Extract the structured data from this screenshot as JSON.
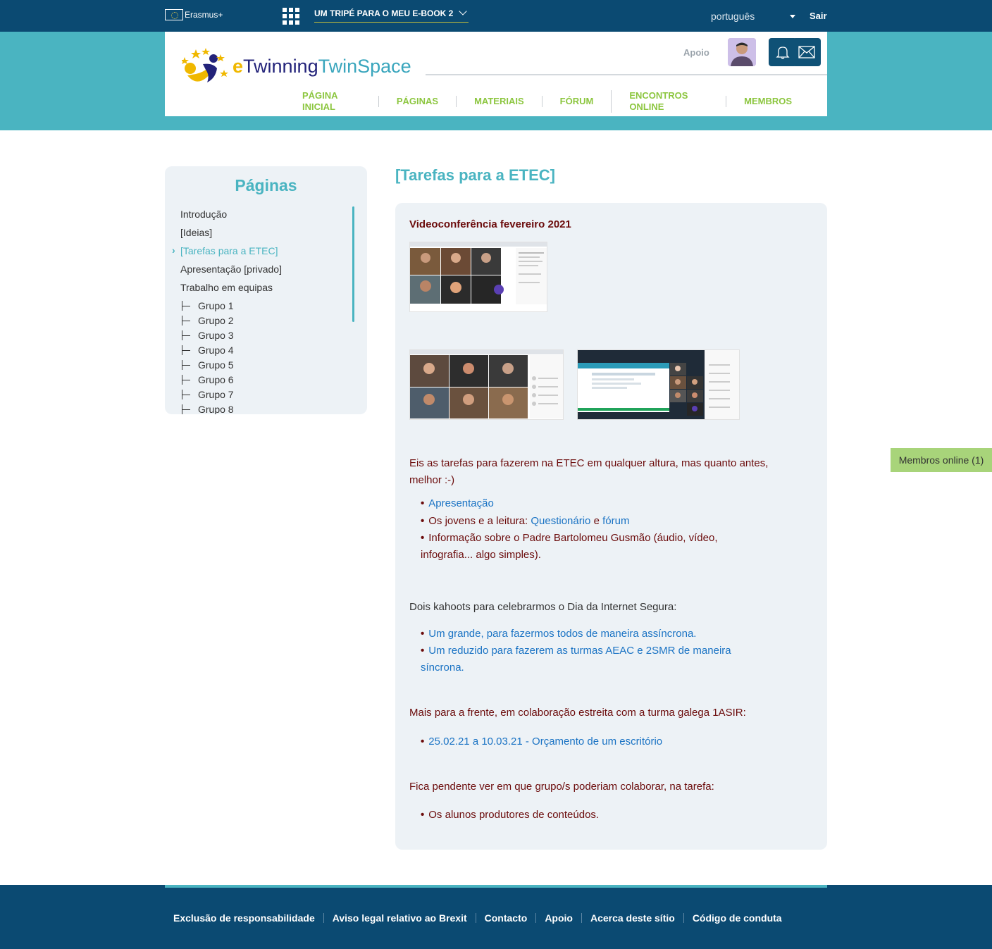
{
  "topbar": {
    "erasmus_label": "Erasmus+",
    "project_title": "UM TRIPÉ PARA O MEU E-BOOK 2",
    "language": "português",
    "logout": "Sair"
  },
  "header": {
    "logo": {
      "e": "e",
      "twinning": "Twinning",
      "twinspace": "TwinSpace"
    },
    "support": "Apoio",
    "nav": [
      "PÁGINA INICIAL",
      "PÁGINAS",
      "MATERIAIS",
      "FÓRUM",
      "ENCONTROS ONLINE",
      "MEMBROS"
    ]
  },
  "sidebar": {
    "title": "Páginas",
    "items": [
      "Introdução",
      "[Ideias]",
      "[Tarefas para a ETEC]",
      "Apresentação [privado]",
      "Trabalho em equipas"
    ],
    "active_item": "[Tarefas para a ETEC]",
    "groups": [
      "Grupo 1",
      "Grupo 2",
      "Grupo 3",
      "Grupo 4",
      "Grupo 5",
      "Grupo 6",
      "Grupo 7",
      "Grupo 8"
    ]
  },
  "content": {
    "page_title": "[Tarefas para a ETEC]",
    "video_heading": "Videoconferência fevereiro 2021",
    "intro_line1": "Eis as tarefas para fazerem na ETEC em qualquer altura, mas quanto antes,",
    "intro_line2": "melhor :-)",
    "task1_link": "Apresentação",
    "task2_prefix": "Os jovens e a leitura: ",
    "task2_link1": "Questionário",
    "task2_mid": " e ",
    "task2_link2": "fórum",
    "task3_line1": "Informação sobre o Padre Bartolomeu Gusmão (áudio, vídeo,",
    "task3_line2": "infografia... algo simples).",
    "kahoot_intro": "Dois kahoots para celebrarmos o Dia da Internet Segura:",
    "kahoot1": "Um grande, para fazermos todos de maneira assíncrona.",
    "kahoot2_line1": "Um reduzido para fazerem as turmas AEAC e 2SMR de maneira",
    "kahoot2_line2": "síncrona.",
    "collab_intro": "Mais para a frente, em colaboração estreita com a turma galega 1ASIR:",
    "collab_item": "25.02.21 a 10.03.21 - Orçamento de um escritório",
    "pending_intro": "Fica pendente ver em que grupo/s poderiam colaborar, na tarefa:",
    "pending_item": "Os alunos produtores de conteúdos."
  },
  "online_members": "Membros online (1)",
  "footer": {
    "links": [
      "Exclusão de responsabilidade",
      "Aviso legal relativo ao Brexit",
      "Contacto",
      "Apoio",
      "Acerca deste sítio",
      "Código de conduta"
    ]
  },
  "colors": {
    "topbar": "#0b4a72",
    "teal": "#4ab4c1",
    "nav_green": "#8cc63f",
    "maroon_text": "#6b0b0b",
    "link_blue": "#1a73c4",
    "card_bg": "#edf2f6"
  },
  "icons": {
    "apps": "grid-icon",
    "notifications": "bell-icon",
    "messages": "envelope-icon",
    "dropdown": "chevron-down-icon"
  }
}
